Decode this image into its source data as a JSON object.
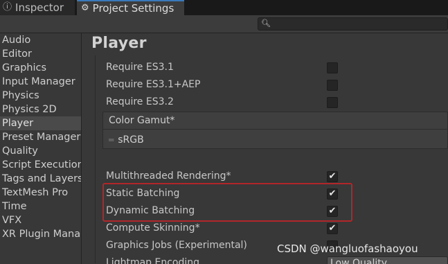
{
  "tabs": {
    "inspector": {
      "label": "Inspector",
      "icon": "info-icon"
    },
    "project_settings": {
      "label": "Project Settings",
      "icon": "gear-icon"
    }
  },
  "search": {
    "placeholder": "",
    "icon": "search-icon"
  },
  "sidebar": {
    "items": [
      {
        "label": "Audio"
      },
      {
        "label": "Editor"
      },
      {
        "label": "Graphics"
      },
      {
        "label": "Input Manager"
      },
      {
        "label": "Physics"
      },
      {
        "label": "Physics 2D"
      },
      {
        "label": "Player",
        "selected": true
      },
      {
        "label": "Preset Manager"
      },
      {
        "label": "Quality"
      },
      {
        "label": "Script Execution"
      },
      {
        "label": "Tags and Layers"
      },
      {
        "label": "TextMesh Pro"
      },
      {
        "label": "Time"
      },
      {
        "label": "VFX"
      },
      {
        "label": "XR Plugin Management"
      }
    ]
  },
  "main": {
    "title": "Player",
    "settings": [
      {
        "label": "Require ES3.1",
        "checked": false
      },
      {
        "label": "Require ES3.1+AEP",
        "checked": false
      },
      {
        "label": "Require ES3.2",
        "checked": false
      },
      {
        "label": "Multithreaded Rendering*",
        "checked": true
      },
      {
        "label": "Static Batching",
        "checked": true
      },
      {
        "label": "Dynamic Batching",
        "checked": true
      },
      {
        "label": "Compute Skinning*",
        "checked": true
      },
      {
        "label": "Graphics Jobs (Experimental)",
        "checked": false
      }
    ],
    "color_gamut": {
      "header": "Color Gamut*",
      "items": [
        "sRGB"
      ]
    },
    "lightmap_encoding": {
      "label": "Lightmap Encoding",
      "value": "Low Quality"
    },
    "checkmark_glyph": "✔",
    "highlight_color": "#b3262a"
  },
  "watermark": "CSDN @wangluofashaoyou"
}
